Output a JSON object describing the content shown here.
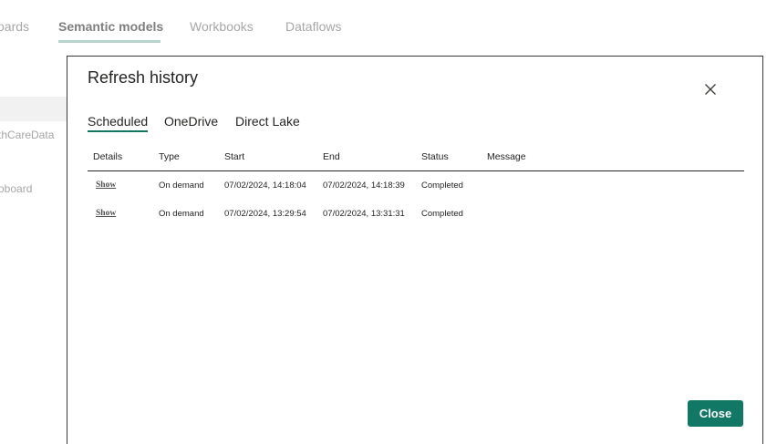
{
  "background": {
    "tabs": [
      {
        "label": "oards"
      },
      {
        "label": "Semantic models"
      },
      {
        "label": "Workbooks"
      },
      {
        "label": "Dataflows"
      }
    ],
    "active_tab": "Semantic models",
    "list_items": [
      {
        "label": "thCareData"
      },
      {
        "label": "oboard"
      }
    ]
  },
  "dialog": {
    "title": "Refresh history",
    "close_icon": "close-icon",
    "tabs": [
      {
        "label": "Scheduled"
      },
      {
        "label": "OneDrive"
      },
      {
        "label": "Direct Lake"
      }
    ],
    "active_tab": "Scheduled",
    "table": {
      "columns": [
        "Details",
        "Type",
        "Start",
        "End",
        "Status",
        "Message"
      ],
      "rows": [
        {
          "details": "Show",
          "type": "On demand",
          "start": "07/02/2024, 14:18:04",
          "end": "07/02/2024, 14:18:39",
          "status": "Completed",
          "message": ""
        },
        {
          "details": "Show",
          "type": "On demand",
          "start": "07/02/2024, 13:29:54",
          "end": "07/02/2024, 13:31:31",
          "status": "Completed",
          "message": ""
        }
      ]
    },
    "close_button": "Close"
  },
  "colors": {
    "accent": "#117865",
    "text": "#252423",
    "muted": "#a7a7a7"
  }
}
